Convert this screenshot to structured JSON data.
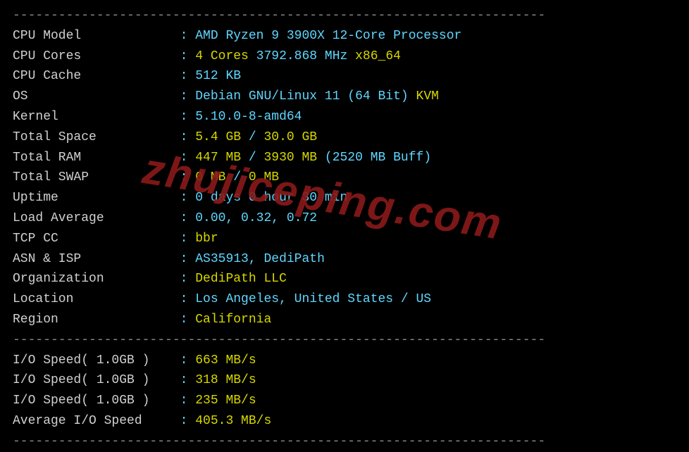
{
  "divider": "----------------------------------------------------------------------",
  "sysinfo": [
    {
      "label": "CPU Model",
      "parts": [
        {
          "cls": "cyan",
          "text": "AMD Ryzen 9 3900X 12-Core Processor"
        }
      ]
    },
    {
      "label": "CPU Cores",
      "parts": [
        {
          "cls": "yellow",
          "text": "4 Cores "
        },
        {
          "cls": "cyan",
          "text": "3792.868 MHz "
        },
        {
          "cls": "yellow",
          "text": "x86_64"
        }
      ]
    },
    {
      "label": "CPU Cache",
      "parts": [
        {
          "cls": "cyan",
          "text": "512 KB"
        }
      ]
    },
    {
      "label": "OS",
      "parts": [
        {
          "cls": "cyan",
          "text": "Debian GNU/Linux 11 (64 Bit) "
        },
        {
          "cls": "yellow",
          "text": "KVM"
        }
      ]
    },
    {
      "label": "Kernel",
      "parts": [
        {
          "cls": "cyan",
          "text": "5.10.0-8-amd64"
        }
      ]
    },
    {
      "label": "Total Space",
      "parts": [
        {
          "cls": "yellow",
          "text": "5.4 GB "
        },
        {
          "cls": "cyan",
          "text": "/ "
        },
        {
          "cls": "yellow",
          "text": "30.0 GB"
        }
      ]
    },
    {
      "label": "Total RAM",
      "parts": [
        {
          "cls": "yellow",
          "text": "447 MB "
        },
        {
          "cls": "cyan",
          "text": "/ "
        },
        {
          "cls": "yellow",
          "text": "3930 MB "
        },
        {
          "cls": "cyan",
          "text": "(2520 MB Buff)"
        }
      ]
    },
    {
      "label": "Total SWAP",
      "parts": [
        {
          "cls": "yellow",
          "text": "0 MB "
        },
        {
          "cls": "cyan",
          "text": "/ "
        },
        {
          "cls": "yellow",
          "text": "0 MB"
        }
      ]
    },
    {
      "label": "Uptime",
      "parts": [
        {
          "cls": "cyan",
          "text": "0 days 0 hour 30 min"
        }
      ]
    },
    {
      "label": "Load Average",
      "parts": [
        {
          "cls": "cyan",
          "text": "0.00, 0.32, 0.72"
        }
      ]
    },
    {
      "label": "TCP CC",
      "parts": [
        {
          "cls": "yellow",
          "text": "bbr"
        }
      ]
    },
    {
      "label": "ASN & ISP",
      "parts": [
        {
          "cls": "cyan",
          "text": "AS35913, DediPath"
        }
      ]
    },
    {
      "label": "Organization",
      "parts": [
        {
          "cls": "yellow",
          "text": "DediPath LLC"
        }
      ]
    },
    {
      "label": "Location",
      "parts": [
        {
          "cls": "cyan",
          "text": "Los Angeles, United States / US"
        }
      ]
    },
    {
      "label": "Region",
      "parts": [
        {
          "cls": "yellow",
          "text": "California"
        }
      ]
    }
  ],
  "iospeed": [
    {
      "label": "I/O Speed( 1.0GB )",
      "parts": [
        {
          "cls": "yellow",
          "text": "663 MB/s"
        }
      ]
    },
    {
      "label": "I/O Speed( 1.0GB )",
      "parts": [
        {
          "cls": "yellow",
          "text": "318 MB/s"
        }
      ]
    },
    {
      "label": "I/O Speed( 1.0GB )",
      "parts": [
        {
          "cls": "yellow",
          "text": "235 MB/s"
        }
      ]
    },
    {
      "label": "Average I/O Speed",
      "parts": [
        {
          "cls": "yellow",
          "text": "405.3 MB/s"
        }
      ]
    }
  ],
  "watermark": "zhujiceping.com",
  "labelWidth": 22
}
